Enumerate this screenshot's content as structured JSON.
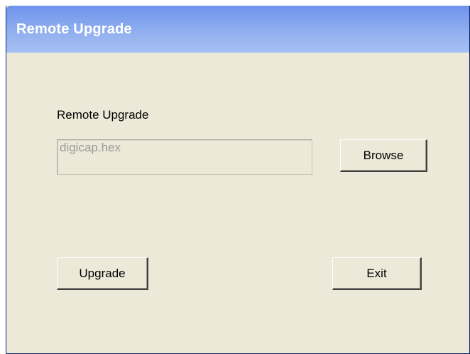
{
  "window": {
    "title": "Remote Upgrade"
  },
  "form": {
    "label": "Remote Upgrade",
    "file_value": "digicap.hex"
  },
  "buttons": {
    "browse": "Browse",
    "upgrade": "Upgrade",
    "exit": "Exit"
  },
  "colors": {
    "titlebar_start": "#6f93ec",
    "titlebar_end": "#a6c0f2",
    "window_bg": "#ece9d8",
    "disabled_text": "#9a9a9a"
  }
}
